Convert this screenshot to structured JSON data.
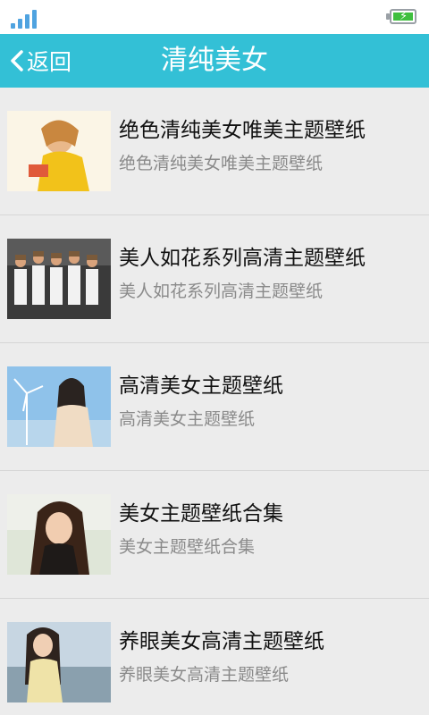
{
  "status_bar": {
    "signal_icon": "signal-strength-icon",
    "battery_icon": "battery-charging-icon"
  },
  "header": {
    "back_label": "返回",
    "title": "清纯美女",
    "background_color": "#33c0d6"
  },
  "items": [
    {
      "title": "绝色清纯美女唯美主题壁纸",
      "subtitle": "绝色清纯美女唯美主题壁纸",
      "thumbnail": "wallpaper-thumbnail"
    },
    {
      "title": "美人如花系列高清主题壁纸",
      "subtitle": "美人如花系列高清主题壁纸",
      "thumbnail": "wallpaper-thumbnail"
    },
    {
      "title": "高清美女主题壁纸",
      "subtitle": "高清美女主题壁纸",
      "thumbnail": "wallpaper-thumbnail"
    },
    {
      "title": "美女主题壁纸合集",
      "subtitle": "美女主题壁纸合集",
      "thumbnail": "wallpaper-thumbnail"
    },
    {
      "title": "养眼美女高清主题壁纸",
      "subtitle": "养眼美女高清主题壁纸",
      "thumbnail": "wallpaper-thumbnail"
    }
  ]
}
